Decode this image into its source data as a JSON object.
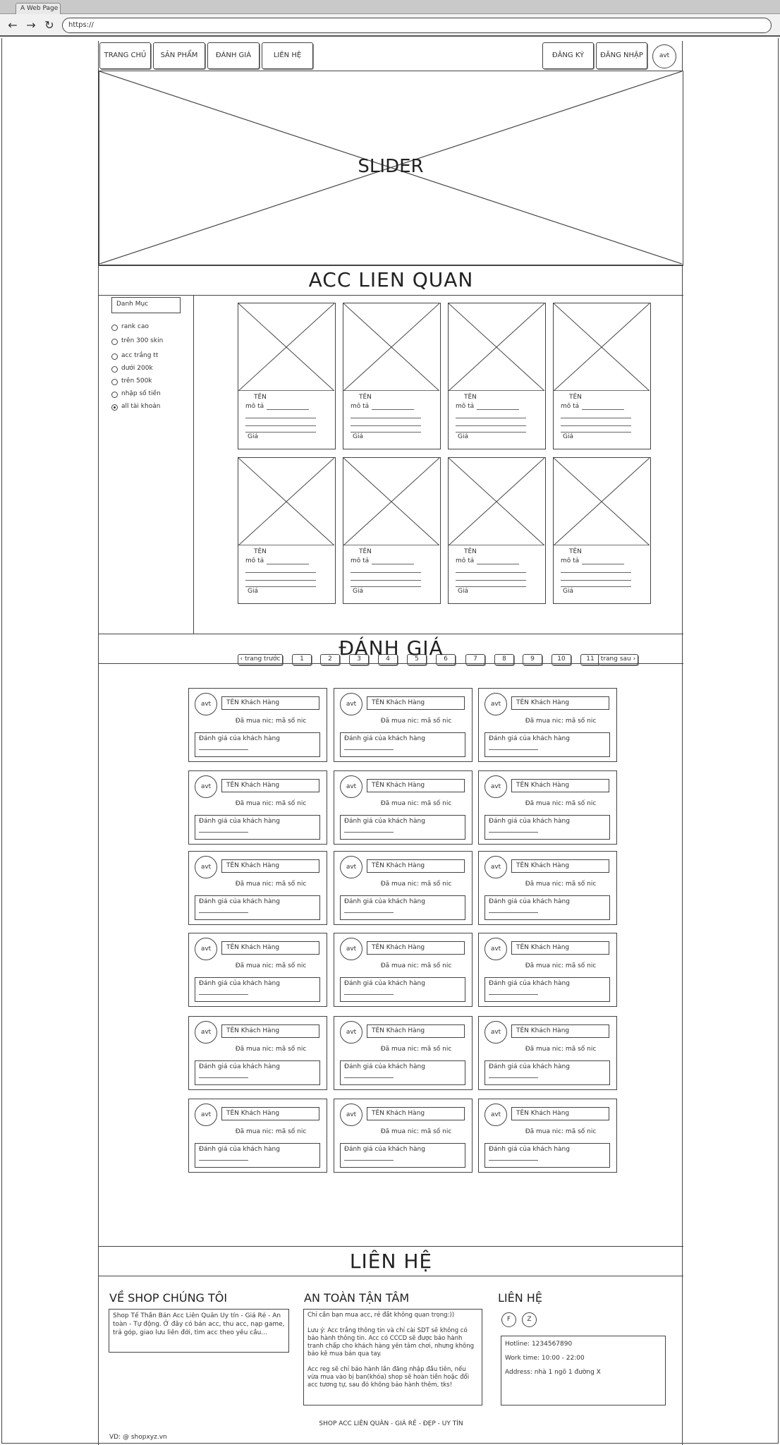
{
  "browser": {
    "tab_title": "A Web Page",
    "url": "https://"
  },
  "nav": {
    "home": "TRANG CHỦ",
    "products": "SẢN PHẨM",
    "reviews": "ĐÁNH GIÁ",
    "contact": "LIÊN HỆ",
    "register": "ĐĂNG KÝ",
    "login": "ĐĂNG NHẬP",
    "avatar": "avt"
  },
  "slider": {
    "label": "SLIDER"
  },
  "products": {
    "title": "ACC LIEN QUAN",
    "category": {
      "header": "Danh Mục",
      "options": [
        "rank cao",
        "trên 300 skin",
        "acc trắng tt",
        "dưới 200k",
        "trên 500k",
        "nhập số tiền",
        "all tài khoản"
      ],
      "selected": "all tài khoản"
    },
    "card": {
      "name": "TÊN",
      "desc": "mô tả",
      "price": "Giá"
    },
    "pagination": {
      "prev": "trang trước",
      "next": "trang sau",
      "pages": [
        "1",
        "2",
        "3",
        "4",
        "5",
        "6",
        "7",
        "8",
        "9",
        "10",
        "11"
      ]
    }
  },
  "reviews": {
    "title": "ĐÁNH GIÁ",
    "avatar": "avt",
    "customer_name": "TÊN Khách Hàng",
    "purchase_note": "Đã mua nic: mã số nic",
    "review_text": "Đánh giá của khách hàng"
  },
  "contact": {
    "title": "LIÊN HỆ",
    "about": {
      "heading": "VỀ SHOP CHÚNG TÔI",
      "text": "Shop Tế Thần Bán Acc Liên Quân Uy tín - Giá Rẻ - An toàn - Tự động. Ở đây có bán acc, thu acc, nạp game, trả góp, giao lưu liên đới, tìm acc theo yêu cầu..."
    },
    "safety": {
      "heading": "AN TOÀN TẬN TÂM",
      "p1": "Chỉ cần bạn mua acc, rẻ đắt không quan trọng:))",
      "p2": "Lưu ý: Acc trắng thông tin và chỉ cài SDT sẽ không có bảo hành thông tin. Acc có CCCD sẽ được bảo hành tranh chấp cho khách hàng yên tâm chơi, nhưng không bảo kê mua bán qua tay.",
      "p3": "Acc reg sẽ chỉ bảo hành lần đăng nhập đầu tiên, nếu vừa mua vào bị ban(khóa) shop sẽ hoàn tiền hoặc đổi acc tương tự, sau đó không bảo hành thêm, tks!"
    },
    "contact": {
      "heading": "LIÊN HỆ",
      "social1": "F",
      "social2": "Z",
      "hotline": "Hotline: 1234567890",
      "work_time": "Work time: 10:00 - 22:00",
      "address": "Address: nhà 1 ngõ 1 đường X"
    }
  },
  "footer": {
    "tagline": "SHOP ACC LIÊN QUÂN - GIÁ RẺ - ĐẸP - UY TÍN",
    "domain": "VD: @ shopxyz.vn"
  }
}
